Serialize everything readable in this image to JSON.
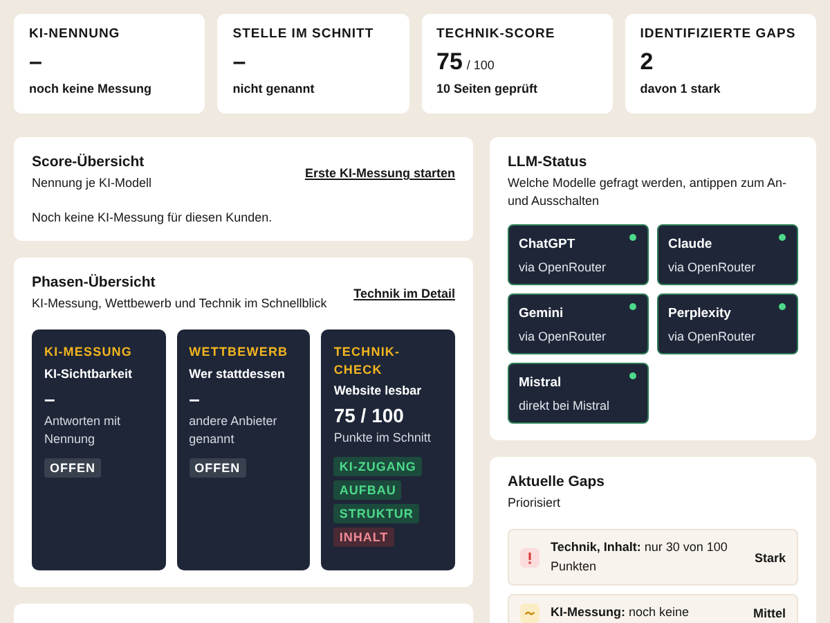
{
  "stats": [
    {
      "label": "KI-NENNUNG",
      "value": "–",
      "note": "noch keine Messung"
    },
    {
      "label": "STELLE IM SCHNITT",
      "value": "–",
      "note": "nicht genannt"
    },
    {
      "label": "TECHNIK-SCORE",
      "value": "75",
      "unit": "/ 100",
      "note": "10 Seiten geprüft"
    },
    {
      "label": "IDENTIFIZIERTE GAPS",
      "value": "2",
      "note": "davon 1 stark"
    }
  ],
  "score_overview": {
    "title": "Score-Übersicht",
    "subtitle": "Nennung je KI-Modell",
    "link": "Erste KI-Messung starten",
    "empty_text": "Noch keine KI-Messung für diesen Kunden."
  },
  "phases": {
    "title": "Phasen-Übersicht",
    "subtitle": "KI-Messung, Wettbewerb und Technik im Schnellblick",
    "link": "Technik im Detail",
    "cards": [
      {
        "heading": "KI-MESSUNG",
        "subtitle": "KI-Sichtbarkeit",
        "value": "–",
        "description": "Antworten mit Nennung",
        "badges": [
          {
            "label": "OFFEN",
            "kind": "neutral"
          }
        ]
      },
      {
        "heading": "WETTBEWERB",
        "subtitle": "Wer stattdessen",
        "value": "–",
        "description": "andere Anbieter genannt",
        "badges": [
          {
            "label": "OFFEN",
            "kind": "neutral"
          }
        ]
      },
      {
        "heading": "TECHNIK-CHECK",
        "subtitle": "Website lesbar",
        "value": "75 / 100",
        "description": "Punkte im Schnitt",
        "badges": [
          {
            "label": "KI-ZUGANG",
            "kind": "good"
          },
          {
            "label": "AUFBAU",
            "kind": "good"
          },
          {
            "label": "STRUKTUR",
            "kind": "good"
          },
          {
            "label": "INHALT",
            "kind": "bad"
          }
        ]
      }
    ]
  },
  "llm_status": {
    "title": "LLM-Status",
    "subtitle": "Welche Modelle gefragt werden, antippen zum An- und Ausschalten",
    "models": [
      {
        "name": "ChatGPT",
        "provider": "via OpenRouter",
        "on": true
      },
      {
        "name": "Claude",
        "provider": "via OpenRouter",
        "on": true
      },
      {
        "name": "Gemini",
        "provider": "via OpenRouter",
        "on": true
      },
      {
        "name": "Perplexity",
        "provider": "via OpenRouter",
        "on": true
      },
      {
        "name": "Mistral",
        "provider": "direkt bei Mistral",
        "on": true
      }
    ]
  },
  "gaps": {
    "title": "Aktuelle Gaps",
    "subtitle": "Priorisiert",
    "items": [
      {
        "kind": "high",
        "text": "**Technik, Inhalt:** nur 30 von 100 Punkten",
        "severity": "Stark"
      },
      {
        "kind": "medium",
        "text": "**KI-Messung:** noch keine",
        "severity": "Mittel"
      }
    ]
  }
}
